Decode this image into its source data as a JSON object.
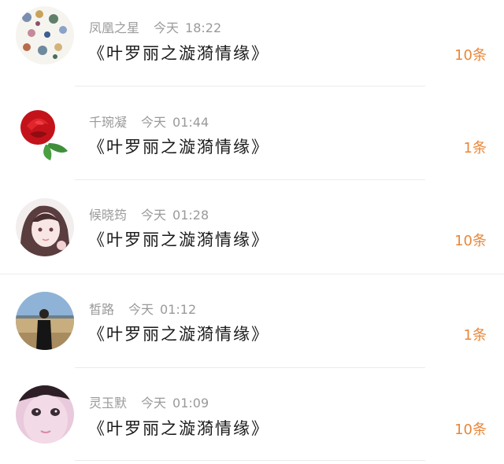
{
  "messages": [
    {
      "name": "凤凰之星",
      "day": "今天",
      "time": "18:22",
      "title": "《叶罗丽之漩漪情缘》",
      "count": "10条",
      "avatar": "floral-pattern-avatar"
    },
    {
      "name": "千琬凝",
      "day": "今天",
      "time": "01:44",
      "title": "《叶罗丽之漩漪情缘》",
      "count": "1条",
      "avatar": "red-rose-avatar"
    },
    {
      "name": "候晓筠",
      "day": "今天",
      "time": "01:28",
      "title": "《叶罗丽之漩漪情缘》",
      "count": "10条",
      "avatar": "anime-girl-avatar"
    },
    {
      "name": "皙路",
      "day": "今天",
      "time": "01:12",
      "title": "《叶罗丽之漩漪情缘》",
      "count": "1条",
      "avatar": "photo-girl-avatar"
    },
    {
      "name": "灵玉默",
      "day": "今天",
      "time": "01:09",
      "title": "《叶罗丽之漩漪情缘》",
      "count": "10条",
      "avatar": "doll-face-avatar"
    }
  ],
  "colors": {
    "count": "#e8873a",
    "meta": "#9a9a9a",
    "title": "#1a1a1a"
  }
}
